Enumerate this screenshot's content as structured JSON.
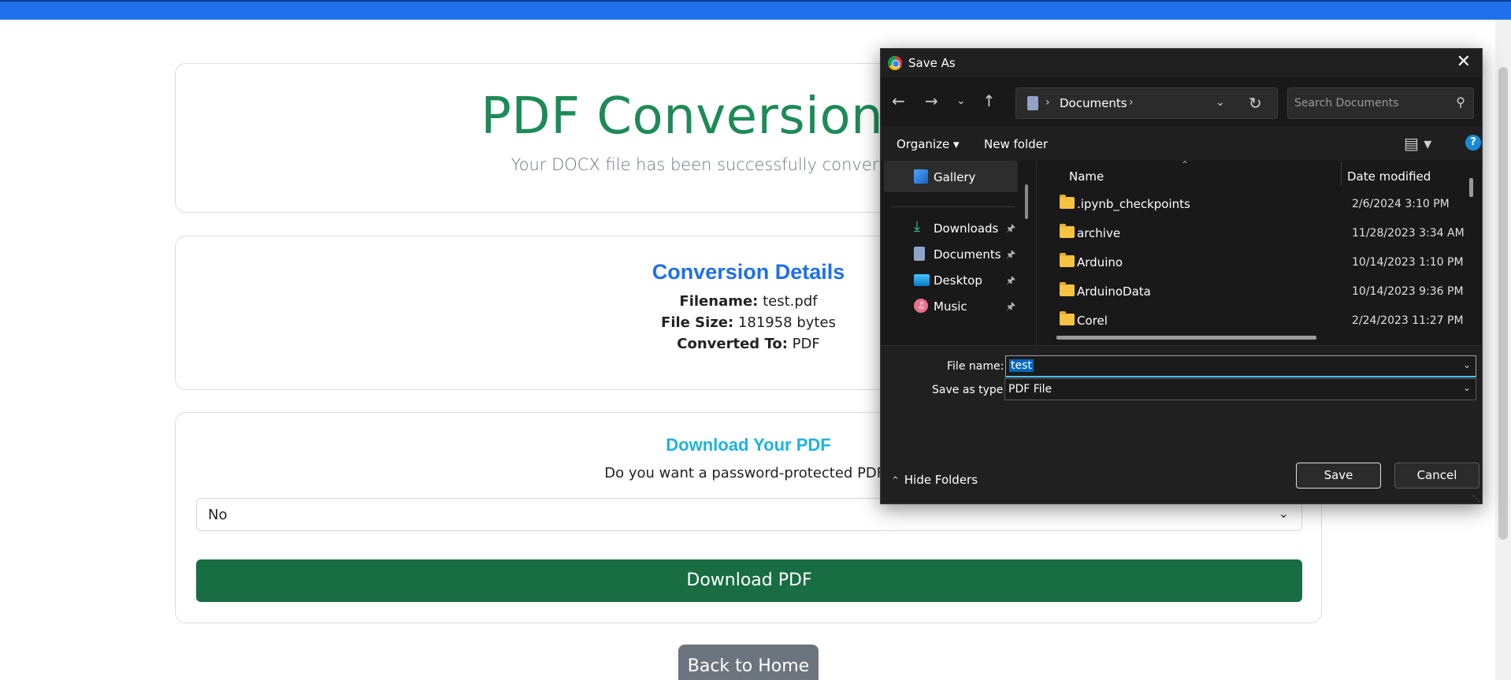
{
  "page": {
    "title": "PDF Conversion Com",
    "subtitle": "Your DOCX file has been successfully converted to PDF. D",
    "details": {
      "heading": "Conversion Details",
      "filename_label": "Filename:",
      "filename_value": "test.pdf",
      "filesize_label": "File Size:",
      "filesize_value": "181958 bytes",
      "converted_label": "Converted To:",
      "converted_value": "PDF"
    },
    "download": {
      "heading": "Download Your PDF",
      "question": "Do you want a password-protected PDF?",
      "select_value": "No",
      "button_label": "Download PDF"
    },
    "back_button": "Back to Home"
  },
  "dialog": {
    "title": "Save As",
    "address": {
      "path": "Documents",
      "search_placeholder": "Search Documents"
    },
    "toolbar": {
      "organize": "Organize",
      "new_folder": "New folder",
      "help": "?"
    },
    "nav_pane": {
      "items": [
        {
          "label": "Gallery",
          "icon": "gallery-icon"
        },
        {
          "label": "Downloads",
          "icon": "downloads-icon",
          "pinned": true
        },
        {
          "label": "Documents",
          "icon": "documents-icon",
          "pinned": true
        },
        {
          "label": "Desktop",
          "icon": "desktop-icon",
          "pinned": true
        },
        {
          "label": "Music",
          "icon": "music-icon",
          "pinned": true
        }
      ]
    },
    "file_list": {
      "columns": [
        "Name",
        "Date modified"
      ],
      "rows": [
        {
          "name": ".ipynb_checkpoints",
          "date": "2/6/2024 3:10 PM"
        },
        {
          "name": "archive",
          "date": "11/28/2023 3:34 AM"
        },
        {
          "name": "Arduino",
          "date": "10/14/2023 1:10 PM"
        },
        {
          "name": "ArduinoData",
          "date": "10/14/2023 9:36 PM"
        },
        {
          "name": "Corel",
          "date": "2/24/2023 11:27 PM"
        }
      ]
    },
    "form": {
      "filename_label": "File name:",
      "filename_value": "test",
      "type_label": "Save as type:",
      "type_value": "PDF File"
    },
    "hide_folders": "Hide Folders",
    "save_button": "Save",
    "cancel_button": "Cancel"
  }
}
